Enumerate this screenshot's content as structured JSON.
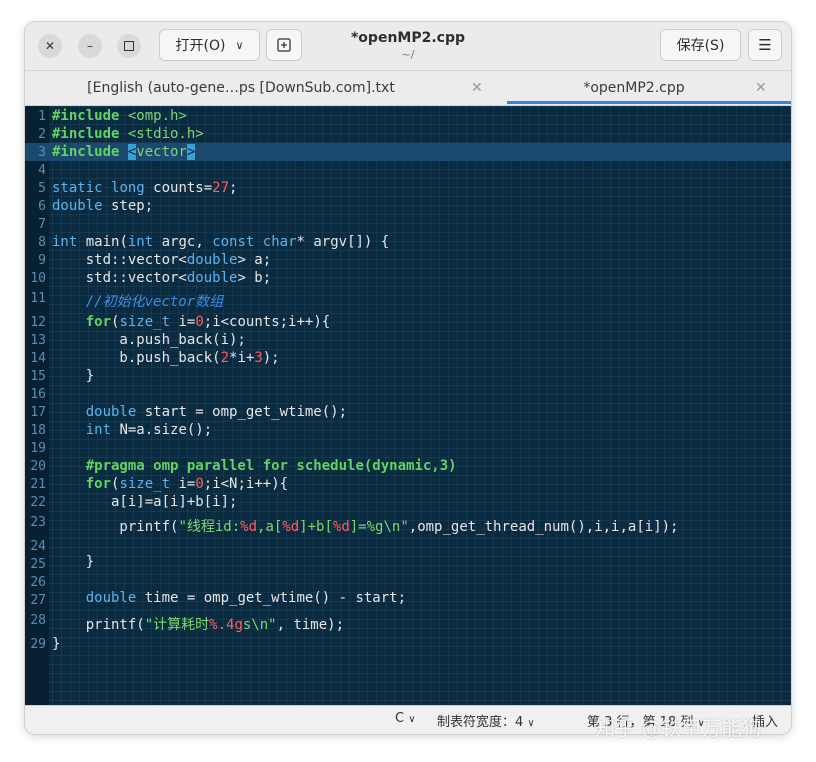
{
  "header": {
    "open_label": "打开(O)",
    "title": "*openMP2.cpp",
    "subtitle": "~/",
    "save_label": "保存(S)"
  },
  "tabs": [
    {
      "label": "[English (auto-gene…ps [DownSub.com].txt",
      "active": false
    },
    {
      "label": "*openMP2.cpp",
      "active": true
    }
  ],
  "editor": {
    "line_numbers": [
      "1",
      "2",
      "3",
      "4",
      "5",
      "6",
      "7",
      "8",
      "9",
      "10",
      "11",
      "12",
      "13",
      "14",
      "15",
      "16",
      "17",
      "18",
      "19",
      "20",
      "21",
      "22",
      "23",
      "24",
      "25",
      "26",
      "27",
      "28",
      "29"
    ],
    "current_line": 3,
    "code": {
      "l1a": "#include ",
      "l1b": "<omp.h>",
      "l2a": "#include ",
      "l2b": "<stdio.h>",
      "l3a": "#include ",
      "l3b": "<",
      "l3c": "vector",
      "l3d": ">",
      "l5a": "static",
      "l5b": " ",
      "l5c": "long",
      "l5d": " counts=",
      "l5e": "27",
      "l5f": ";",
      "l6a": "double",
      "l6b": " step;",
      "l8a": "int",
      "l8b": " main(",
      "l8c": "int",
      "l8d": " argc, ",
      "l8e": "const",
      "l8f": " ",
      "l8g": "char",
      "l8h": "* argv[]) {",
      "l9a": "    std::vector<",
      "l9b": "double",
      "l9c": "> a;",
      "l10a": "    std::vector<",
      "l10b": "double",
      "l10c": "> b;",
      "l11a": "    ",
      "l11b": "//初始化vector数组",
      "l12a": "    ",
      "l12b": "for",
      "l12c": "(",
      "l12d": "size_t",
      "l12e": " i=",
      "l12f": "0",
      "l12g": ";i<counts;i++){",
      "l13a": "        a.push_back(i);",
      "l14a": "        b.push_back(",
      "l14b": "2",
      "l14c": "*i+",
      "l14d": "3",
      "l14e": ");",
      "l15a": "    }",
      "l17a": "    ",
      "l17b": "double",
      "l17c": " start = omp_get_wtime();",
      "l18a": "    ",
      "l18b": "int",
      "l18c": " N=a.size();",
      "l20a": "    ",
      "l20b": "#pragma omp parallel for schedule(dynamic,3)",
      "l21a": "    ",
      "l21b": "for",
      "l21c": "(",
      "l21d": "size_t",
      "l21e": " i=",
      "l21f": "0",
      "l21g": ";i<N;i++){",
      "l22a": "       a[i]=a[i]+b[i];",
      "l23a": "        printf(",
      "l23b": "\"线程id:",
      "l23c": "%d",
      "l23d": ",a[",
      "l23e": "%d",
      "l23f": "]+b[",
      "l23g": "%d",
      "l23h": "]=",
      "l23i": "%g\\n\"",
      "l23j": ",omp_get_thread_num(),i,i,a[i]);",
      "l25a": "    }",
      "l27a": "    ",
      "l27b": "double",
      "l27c": " time = omp_get_wtime() - start;",
      "l28a": "    printf(",
      "l28b": "\"计算耗时",
      "l28c": "%.4g",
      "l28d": "s\\n\"",
      "l28e": ", time);",
      "l29a": "}"
    }
  },
  "statusbar": {
    "language": "C",
    "tab_width": "制表符宽度：4",
    "position": "第 3 行，第 18 列",
    "mode": "插入"
  },
  "watermark": "知乎 @铁甲万能狗",
  "colors": {
    "editor_bg": "#0a2a40",
    "keyword": "#62d462",
    "type": "#5ab3ee",
    "number": "#ff5f5f",
    "comment": "#3a8ee6",
    "accent": "#3584e4"
  }
}
